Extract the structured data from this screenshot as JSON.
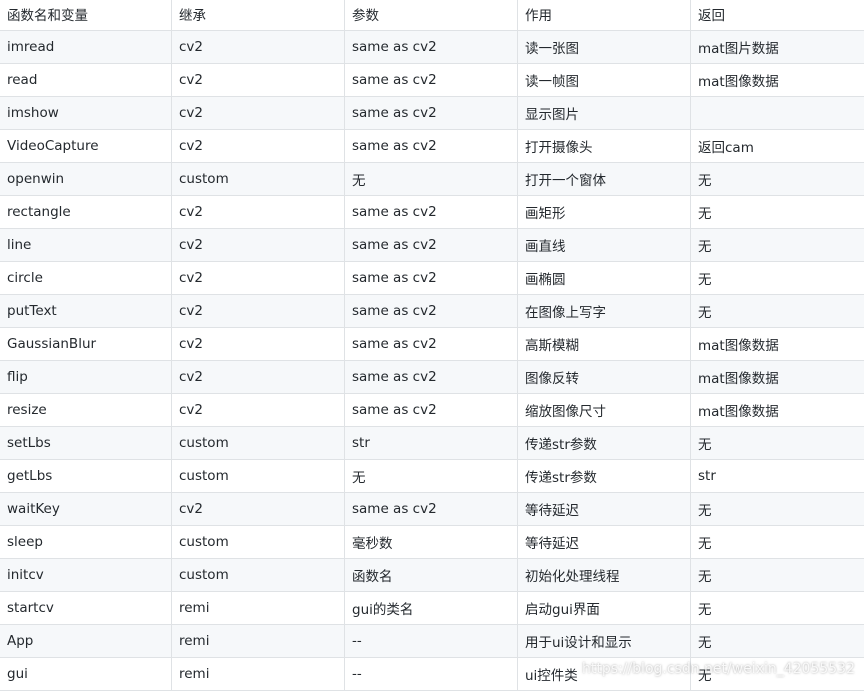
{
  "table": {
    "headers": [
      "函数名和变量",
      "继承",
      "参数",
      "作用",
      "返回"
    ],
    "rows": [
      [
        "imread",
        "cv2",
        "same as cv2",
        "读一张图",
        "mat图片数据"
      ],
      [
        "read",
        "cv2",
        "same as cv2",
        "读一帧图",
        "mat图像数据"
      ],
      [
        "imshow",
        "cv2",
        "same as cv2",
        "显示图片",
        ""
      ],
      [
        "VideoCapture",
        "cv2",
        "same as cv2",
        "打开摄像头",
        "返回cam"
      ],
      [
        "openwin",
        "custom",
        "无",
        "打开一个窗体",
        "无"
      ],
      [
        "rectangle",
        "cv2",
        "same as cv2",
        "画矩形",
        "无"
      ],
      [
        "line",
        "cv2",
        "same as cv2",
        "画直线",
        "无"
      ],
      [
        "circle",
        "cv2",
        "same as cv2",
        "画椭圆",
        "无"
      ],
      [
        "putText",
        "cv2",
        "same as cv2",
        "在图像上写字",
        "无"
      ],
      [
        "GaussianBlur",
        "cv2",
        "same as cv2",
        "高斯模糊",
        "mat图像数据"
      ],
      [
        "flip",
        "cv2",
        "same as cv2",
        "图像反转",
        "mat图像数据"
      ],
      [
        "resize",
        "cv2",
        "same as cv2",
        "缩放图像尺寸",
        "mat图像数据"
      ],
      [
        "setLbs",
        "custom",
        "str",
        "传递str参数",
        "无"
      ],
      [
        "getLbs",
        "custom",
        "无",
        "传递str参数",
        "str"
      ],
      [
        "waitKey",
        "cv2",
        "same as cv2",
        "等待延迟",
        "无"
      ],
      [
        "sleep",
        "custom",
        "毫秒数",
        "等待延迟",
        "无"
      ],
      [
        "initcv",
        "custom",
        "函数名",
        "初始化处理线程",
        "无"
      ],
      [
        "startcv",
        "remi",
        "gui的类名",
        "启动gui界面",
        "无"
      ],
      [
        "App",
        "remi",
        "--",
        "用于ui设计和显示",
        "无"
      ],
      [
        "gui",
        "remi",
        "--",
        "ui控件类",
        "无"
      ]
    ]
  },
  "watermark": "https://blog.csdn.net/weixin_42055532"
}
